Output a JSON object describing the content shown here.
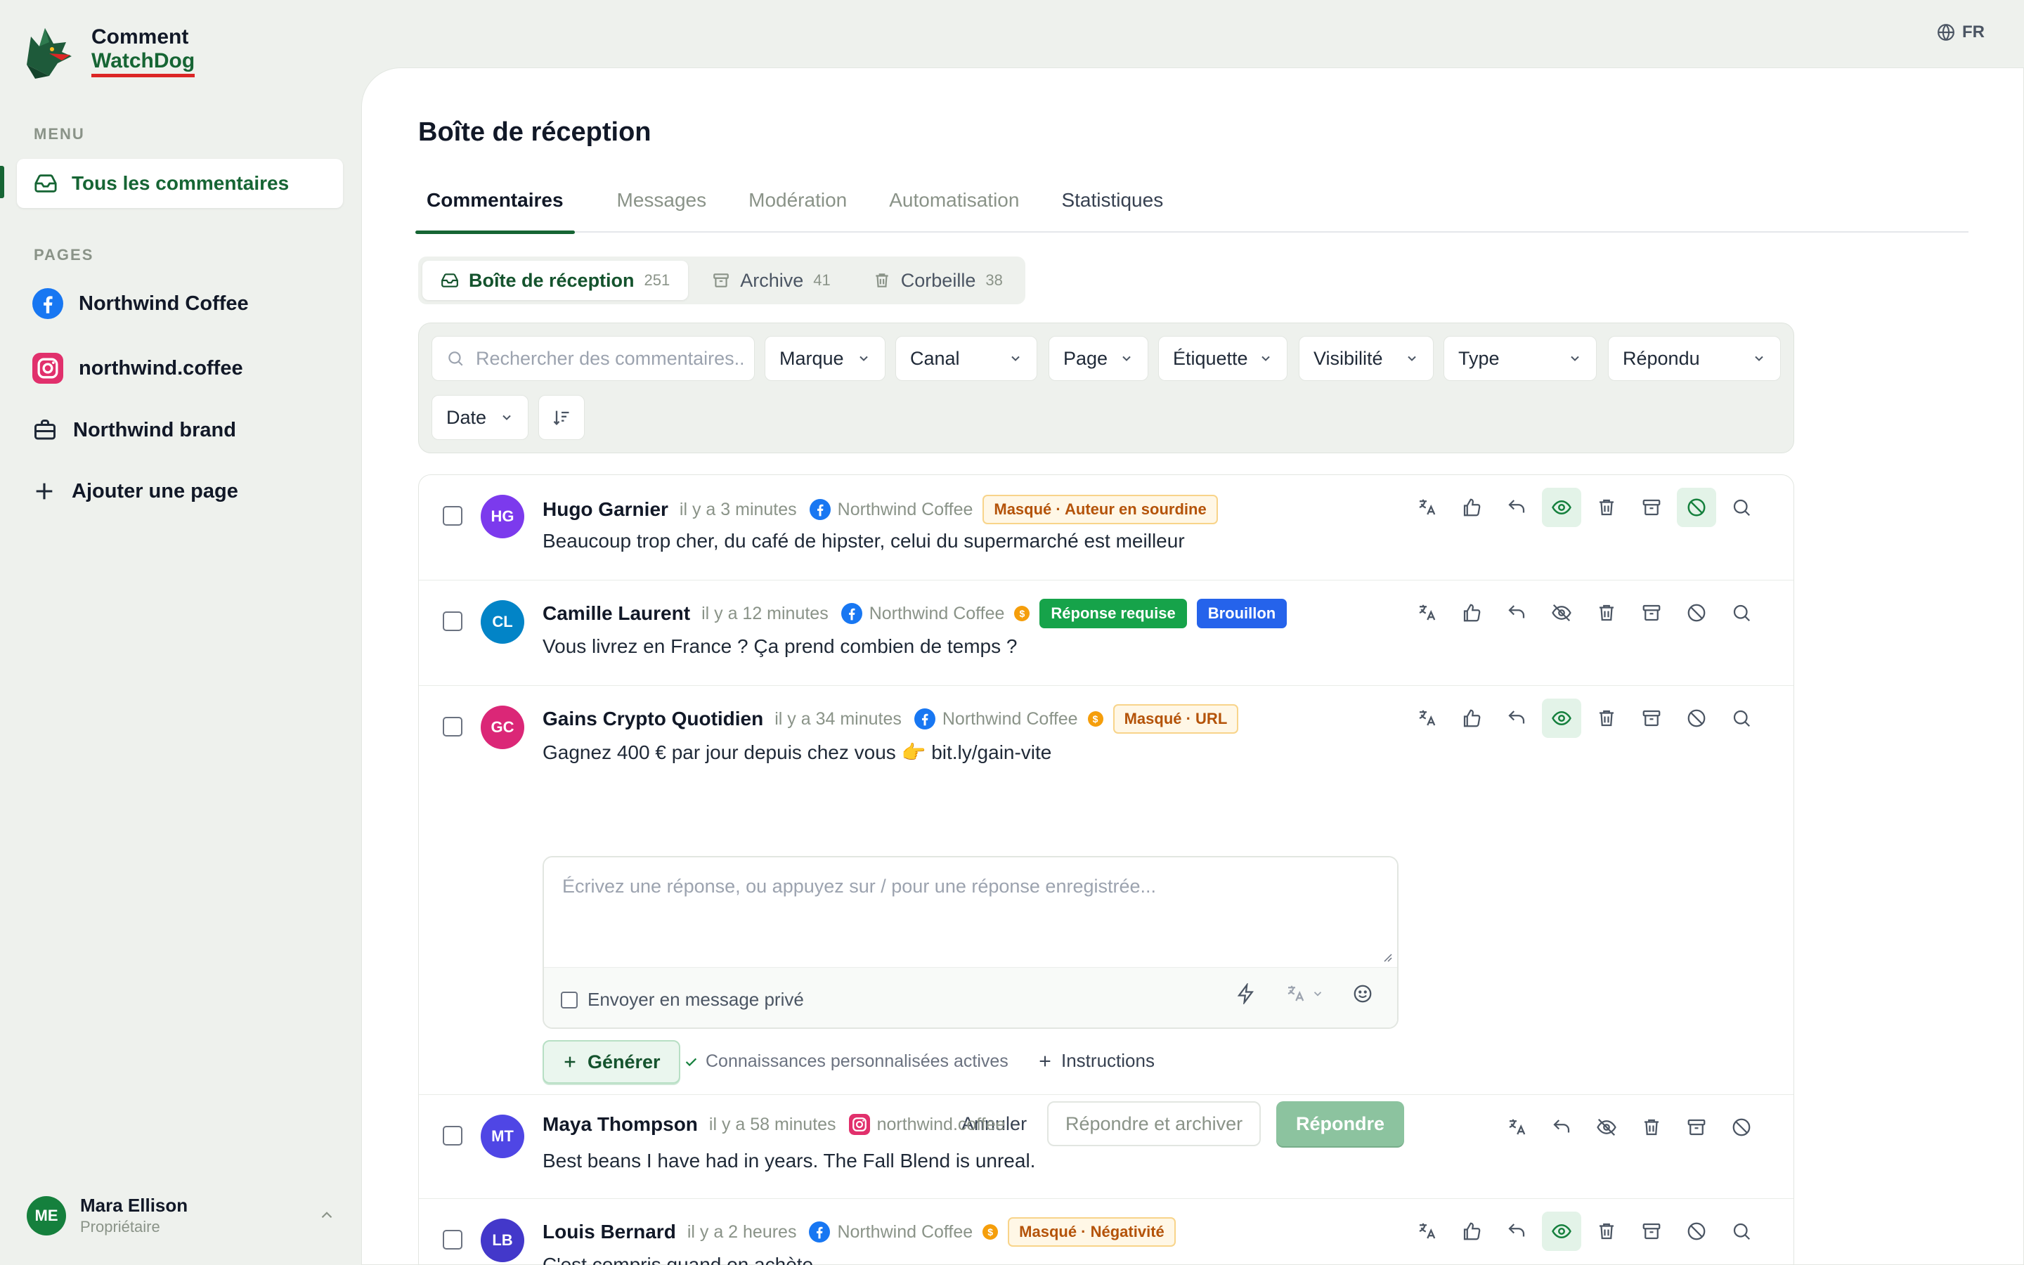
{
  "app": {
    "logo_line1": "Comment",
    "logo_line2": "WatchDog",
    "language": "FR"
  },
  "sidebar": {
    "menu_label": "MENU",
    "all_comments": "Tous les commentaires",
    "pages_label": "PAGES",
    "pages": [
      {
        "name": "Northwind Coffee",
        "icon": "facebook-icon"
      },
      {
        "name": "northwind.coffee",
        "icon": "instagram-icon"
      },
      {
        "name": "Northwind brand",
        "icon": "briefcase-icon"
      }
    ],
    "add_page": "Ajouter une page",
    "user": {
      "initials": "ME",
      "name": "Mara Ellison",
      "role": "Propriétaire"
    }
  },
  "main": {
    "title": "Boîte de réception",
    "tabs": [
      "Commentaires",
      "Messages",
      "Modération",
      "Automatisation",
      "Statistiques"
    ],
    "segments": [
      {
        "label": "Boîte de réception",
        "count": "251"
      },
      {
        "label": "Archive",
        "count": "41"
      },
      {
        "label": "Corbeille",
        "count": "38"
      }
    ],
    "filters": {
      "search_placeholder": "Rechercher des commentaires...",
      "brand": "Marque",
      "channel": "Canal",
      "page": "Page",
      "label": "Étiquette",
      "visibility": "Visibilité",
      "type": "Type",
      "answered": "Répondu",
      "date": "Date"
    }
  },
  "comments": [
    {
      "initials": "HG",
      "color": "#7c3aed",
      "author": "Hugo Garnier",
      "time": "il y a 3 minutes",
      "source": "Northwind Coffee",
      "channel": "facebook",
      "tags": [
        {
          "text": "Masqué · Auteur en sourdine",
          "style": "amber"
        }
      ],
      "text": "Beaucoup trop cher, du café de hipster, celui du supermarché est meilleur"
    },
    {
      "initials": "CL",
      "color": "#0284c7",
      "author": "Camille Laurent",
      "time": "il y a 12 minutes",
      "source": "Northwind Coffee",
      "channel": "facebook",
      "tags": [
        {
          "text": "Réponse requise",
          "style": "green"
        },
        {
          "text": "Brouillon",
          "style": "blue"
        }
      ],
      "text": "Vous livrez en France ? Ça prend combien de temps ?"
    },
    {
      "initials": "GC",
      "color": "#db2777",
      "author": "Gains Crypto Quotidien",
      "time": "il y a 34 minutes",
      "source": "Northwind Coffee",
      "channel": "facebook",
      "tags": [
        {
          "text": "Masqué · URL",
          "style": "amber"
        }
      ],
      "text": "Gagnez 400 € par jour depuis chez vous 👉  bit.ly/gain-vite"
    },
    {
      "initials": "MT",
      "color": "#4f46e5",
      "author": "Maya Thompson",
      "time": "il y a 58 minutes",
      "source": "northwind.coffee",
      "channel": "instagram",
      "tags": [],
      "text": "Best beans I have had in years. The Fall Blend is unreal."
    },
    {
      "initials": "LB",
      "color": "#4338ca",
      "author": "Louis Bernard",
      "time": "il y a 2 heures",
      "source": "Northwind Coffee",
      "channel": "facebook",
      "tags": [
        {
          "text": "Masqué · Négativité",
          "style": "amber"
        }
      ],
      "text": "C'est compris quand on achète"
    }
  ],
  "reply": {
    "placeholder": "Écrivez une réponse, ou appuyez sur / pour une réponse enregistrée...",
    "private_message": "Envoyer en message privé",
    "generate": "Générer",
    "knowledge": "Connaissances personnalisées actives",
    "instructions": "Instructions",
    "cancel": "Annuler",
    "reply_archive": "Répondre et archiver",
    "reply": "Répondre"
  },
  "colors": {
    "accent": "#166534",
    "background": "#eef1ed",
    "facebook": "#1877f2",
    "instagram": "#e1306c"
  }
}
